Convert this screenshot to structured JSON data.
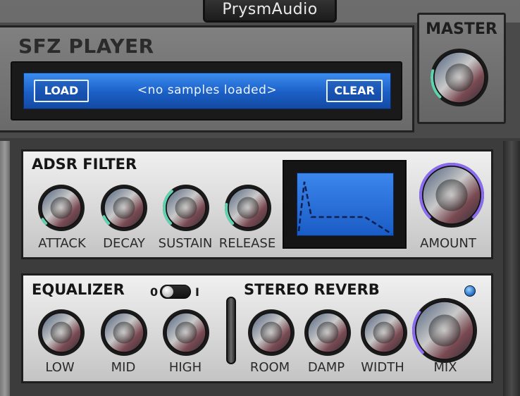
{
  "brand": {
    "name": "PrysmAudio"
  },
  "player": {
    "title": "SFZ PLAYER",
    "load_label": "LOAD",
    "status_text": "<no samples loaded>",
    "clear_label": "CLEAR"
  },
  "master": {
    "title": "MASTER",
    "level": 0.22
  },
  "adsr": {
    "title": "ADSR FILTER",
    "knobs": [
      {
        "label": "ATTACK",
        "value": 0.05
      },
      {
        "label": "DECAY",
        "value": 0.08
      },
      {
        "label": "SUSTAIN",
        "value": 0.35
      },
      {
        "label": "RELEASE",
        "value": 0.2
      }
    ],
    "amount": {
      "label": "AMOUNT",
      "value": 1.0
    }
  },
  "equalizer": {
    "title": "EQUALIZER",
    "toggle_off_label": "0",
    "toggle_on_label": "I",
    "toggle_on": false,
    "knobs": [
      {
        "label": "LOW",
        "value": 0.0
      },
      {
        "label": "MID",
        "value": 0.0
      },
      {
        "label": "HIGH",
        "value": 0.0
      }
    ]
  },
  "reverb": {
    "title": "STEREO REVERB",
    "knobs": [
      {
        "label": "ROOM",
        "value": 0.0
      },
      {
        "label": "DAMP",
        "value": 0.0
      },
      {
        "label": "WIDTH",
        "value": 0.0
      }
    ],
    "mix": {
      "label": "MIX",
      "value": 0.3
    }
  },
  "colors": {
    "lcd_blue": "#1b5fc6",
    "ring_green": "#5fd3b0",
    "ring_purple": "#8a6cf0",
    "ring_blue": "#6fa8ff"
  }
}
